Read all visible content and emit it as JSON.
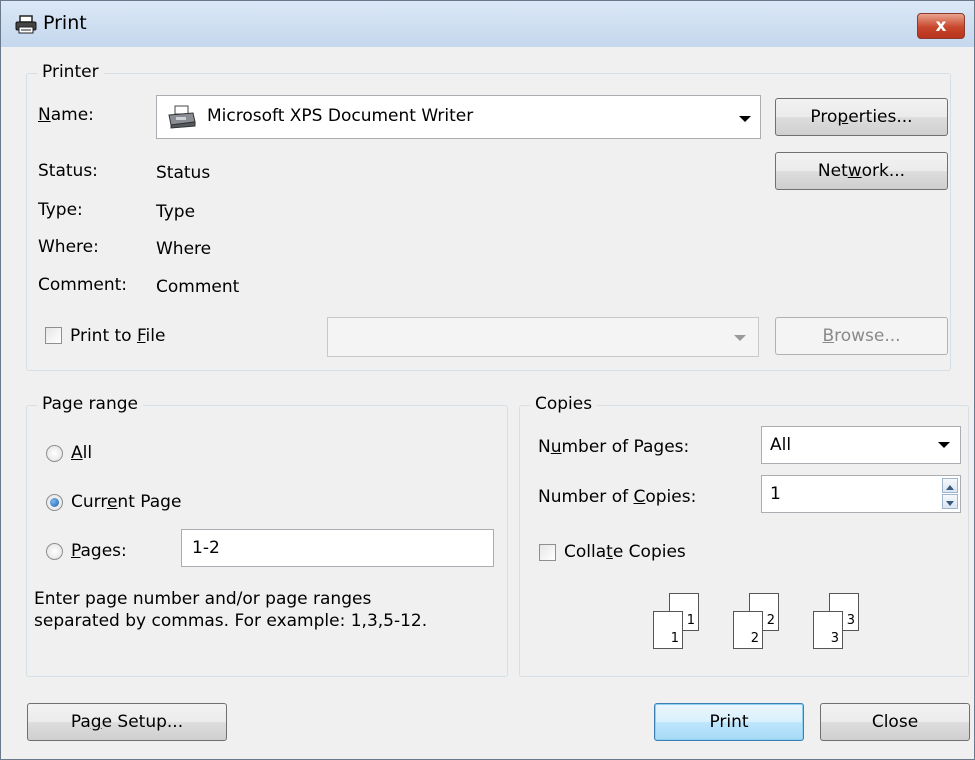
{
  "window": {
    "title": "Print",
    "icon": "printer-icon",
    "close_label": "x"
  },
  "printer_group": {
    "label": "Printer",
    "name_label_pre": "",
    "name_label_u": "N",
    "name_label_post": "ame:",
    "selected_printer": "Microsoft XPS Document Writer",
    "properties_pre": "Pro",
    "properties_u": "p",
    "properties_post": "erties...",
    "network_pre": "Net",
    "network_u": "w",
    "network_post": "ork...",
    "status_label": "Status:",
    "status_value": "Status",
    "type_label": "Type:",
    "type_value": "Type",
    "where_label": "Where:",
    "where_value": "Where",
    "comment_label": "Comment:",
    "comment_value": "Comment",
    "print_to_file_pre": "Print to ",
    "print_to_file_u": "F",
    "print_to_file_post": "ile",
    "browse_pre": "",
    "browse_u": "B",
    "browse_post": "rowse..."
  },
  "page_range": {
    "label": "Page range",
    "all_pre": "",
    "all_u": "A",
    "all_post": "ll",
    "current_pre": "Curr",
    "current_u": "e",
    "current_post": "nt Page",
    "pages_pre": "",
    "pages_u": "P",
    "pages_post": "ages:",
    "pages_value": "1-2",
    "hint_line1": "Enter page number and/or page ranges",
    "hint_line2": "separated by commas. For example: 1,3,5-12.",
    "selected": "current"
  },
  "copies": {
    "label": "Copies",
    "num_pages_pre": "N",
    "num_pages_u": "u",
    "num_pages_post": "mber of Pages:",
    "num_pages_value": "All",
    "num_copies_pre": "Number of ",
    "num_copies_u": "C",
    "num_copies_post": "opies:",
    "num_copies_value": "1",
    "collate_pre": "Colla",
    "collate_u": "t",
    "collate_post": "e Copies",
    "collate_checked": false,
    "collate_pages": [
      {
        "back": "1",
        "front": "1"
      },
      {
        "back": "2",
        "front": "2"
      },
      {
        "back": "3",
        "front": "3"
      }
    ]
  },
  "footer": {
    "page_setup_pre": "Pa",
    "page_setup_u": "g",
    "page_setup_post": "e Setup...",
    "print_label": "Print",
    "close_label": "Close"
  },
  "colors": {
    "title_bar": "#c4d7ee",
    "close_button": "#c8472c",
    "default_button_border": "#3c7fb1",
    "dialog_bg": "#f0f0f0"
  }
}
